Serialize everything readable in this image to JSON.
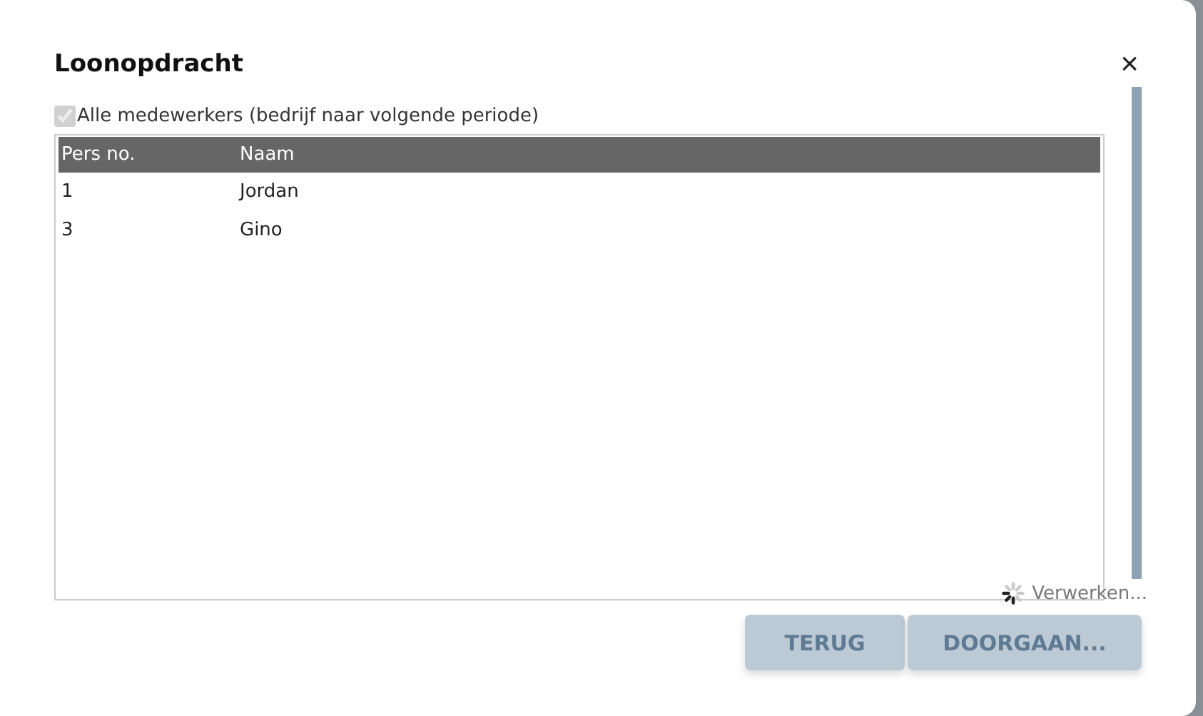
{
  "dialog": {
    "title": "Loonopdracht",
    "close": "×"
  },
  "all_employees": {
    "label": "Alle medewerkers (bedrijf naar volgende periode)",
    "checked": true,
    "disabled": true
  },
  "table": {
    "columns": [
      "Pers no.",
      "Naam"
    ],
    "rows": [
      {
        "cells": [
          "1",
          "Jordan"
        ]
      },
      {
        "cells": [
          "3",
          "Gino"
        ]
      }
    ]
  },
  "status": {
    "text": "Verwerken...",
    "busy": true
  },
  "buttons": [
    {
      "label": "TERUG",
      "disabled": true
    },
    {
      "label": "DOORGAAN...",
      "disabled": true
    }
  ]
}
